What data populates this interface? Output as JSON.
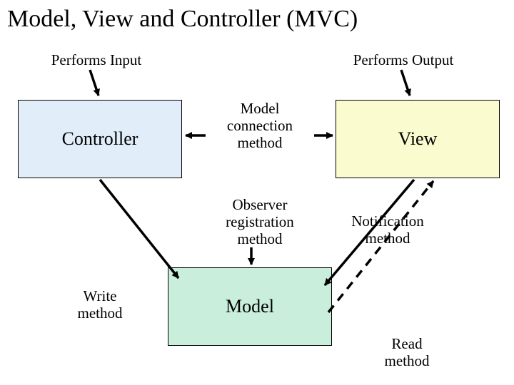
{
  "title": "Model, View and Controller (MVC)",
  "labels": {
    "performs_input": "Performs Input",
    "performs_output": "Performs Output",
    "model_connection_method": "Model\nconnection\nmethod",
    "observer_registration_method": "Observer\nregistration\nmethod",
    "notification_method": "Notification\nmethod",
    "write_method": "Write\nmethod",
    "read_method": "Read\nmethod"
  },
  "boxes": {
    "controller": "Controller",
    "view": "View",
    "model": "Model"
  },
  "colors": {
    "controller_bg": "#e1eef9",
    "view_bg": "#fbfbd0",
    "model_bg": "#c9efdc"
  }
}
